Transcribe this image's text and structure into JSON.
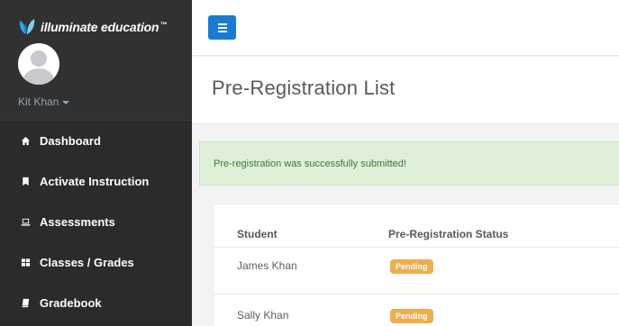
{
  "brand": {
    "name": "illuminate education",
    "trademark": "™"
  },
  "user": {
    "name": "Kit Khan"
  },
  "nav": [
    {
      "label": "Dashboard",
      "icon": "home-icon"
    },
    {
      "label": "Activate Instruction",
      "icon": "bookmark-icon"
    },
    {
      "label": "Assessments",
      "icon": "laptop-icon"
    },
    {
      "label": "Classes / Grades",
      "icon": "grid-icon"
    },
    {
      "label": "Gradebook",
      "icon": "book-icon"
    }
  ],
  "page": {
    "title": "Pre-Registration List"
  },
  "alert": {
    "message": "Pre-registration was successfully submitted!"
  },
  "table": {
    "columns": [
      "Student",
      "Pre-Registration Status"
    ],
    "rows": [
      {
        "student": "James Khan",
        "status": "Pending"
      },
      {
        "student": "Sally Khan",
        "status": "Pending"
      }
    ]
  },
  "colors": {
    "sidebar": "#2a2b2d",
    "accent": "#1a7bd3",
    "alert_bg": "#dff0d8",
    "alert_text": "#3c763d",
    "pending": "#f0ad4e"
  }
}
